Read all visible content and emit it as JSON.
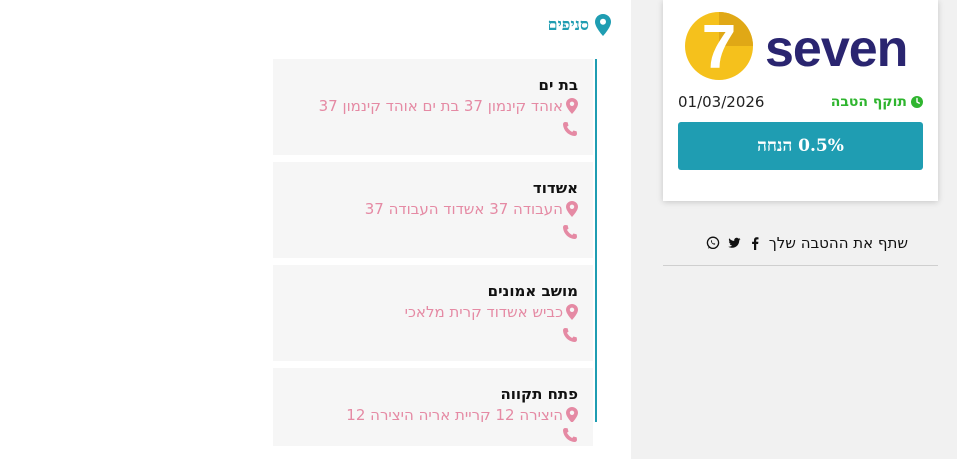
{
  "coupon": {
    "brand_name": "seven",
    "logo_numeral": "7",
    "validity_label": "תוקף הטבה",
    "validity_date": "01/03/2026",
    "discount_label": "0.5% הנחה"
  },
  "share": {
    "label": "שתף את ההטבה שלך",
    "icons": [
      "facebook-icon",
      "twitter-icon",
      "whatsapp-icon"
    ]
  },
  "branches": {
    "heading": "סניפים",
    "items": [
      {
        "city": "בת ים",
        "address": "אוהד קינמון 37 בת ים אוהד קינמון 37"
      },
      {
        "city": "אשדוד",
        "address": "העבודה 37 אשדוד העבודה 37"
      },
      {
        "city": "מושב אמונים",
        "address": "כביש אשדוד קרית מלאכי"
      },
      {
        "city": "פתח תקווה",
        "address": "היצירה 12 קריית אריה היצירה 12"
      }
    ]
  },
  "colors": {
    "accent": "#1f9db2",
    "validity_green": "#2fb52f",
    "address_pink": "#e58aa4",
    "logo_yellow": "#f5c11c",
    "logo_navy": "#2a2570"
  }
}
